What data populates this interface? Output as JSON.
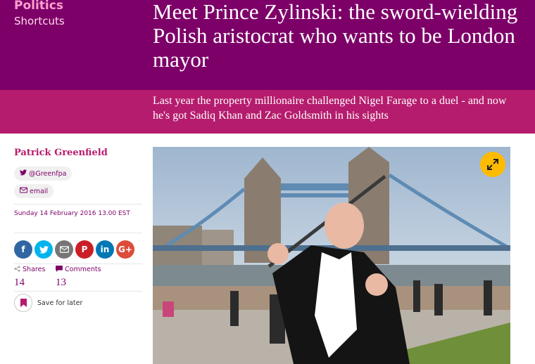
{
  "header": {
    "section": "Politics",
    "series": "Shortcuts",
    "headline": "Meet Prince Zylinski: the sword-wielding Polish aristocrat who wants to be London mayor",
    "standfirst": "Last year the property millionaire challenged Nigel Farage to a duel - and now he's got Sadiq Khan and Zac Goldsmith in his sights"
  },
  "meta": {
    "author": "Patrick Greenfield",
    "twitter": "@Greenfpa",
    "email": "email",
    "dateline": "Sunday 14 February 2016 13.00 EST",
    "shares_label": "Shares",
    "shares_count": "14",
    "comments_label": "Comments",
    "comments_count": "13",
    "save_label": "Save for later"
  },
  "share_buttons": [
    {
      "name": "facebook",
      "glyph": "f",
      "color": "#3067a3"
    },
    {
      "name": "twitter",
      "glyph": "t",
      "color": "#03b3ee"
    },
    {
      "name": "email",
      "glyph": "✉",
      "color": "#767676"
    },
    {
      "name": "pinterest",
      "glyph": "P",
      "color": "#cb1f27"
    },
    {
      "name": "linkedin",
      "glyph": "in",
      "color": "#0077b5"
    },
    {
      "name": "google-plus",
      "glyph": "G+",
      "color": "#dd4b39"
    }
  ],
  "colors": {
    "header_dark": "#7d0068",
    "header_light": "#b51c6d",
    "accent": "#ffbb00"
  },
  "icons": {
    "expand": "expand-icon",
    "save": "bookmark-icon",
    "share": "share-icon",
    "comment": "comment-icon"
  }
}
